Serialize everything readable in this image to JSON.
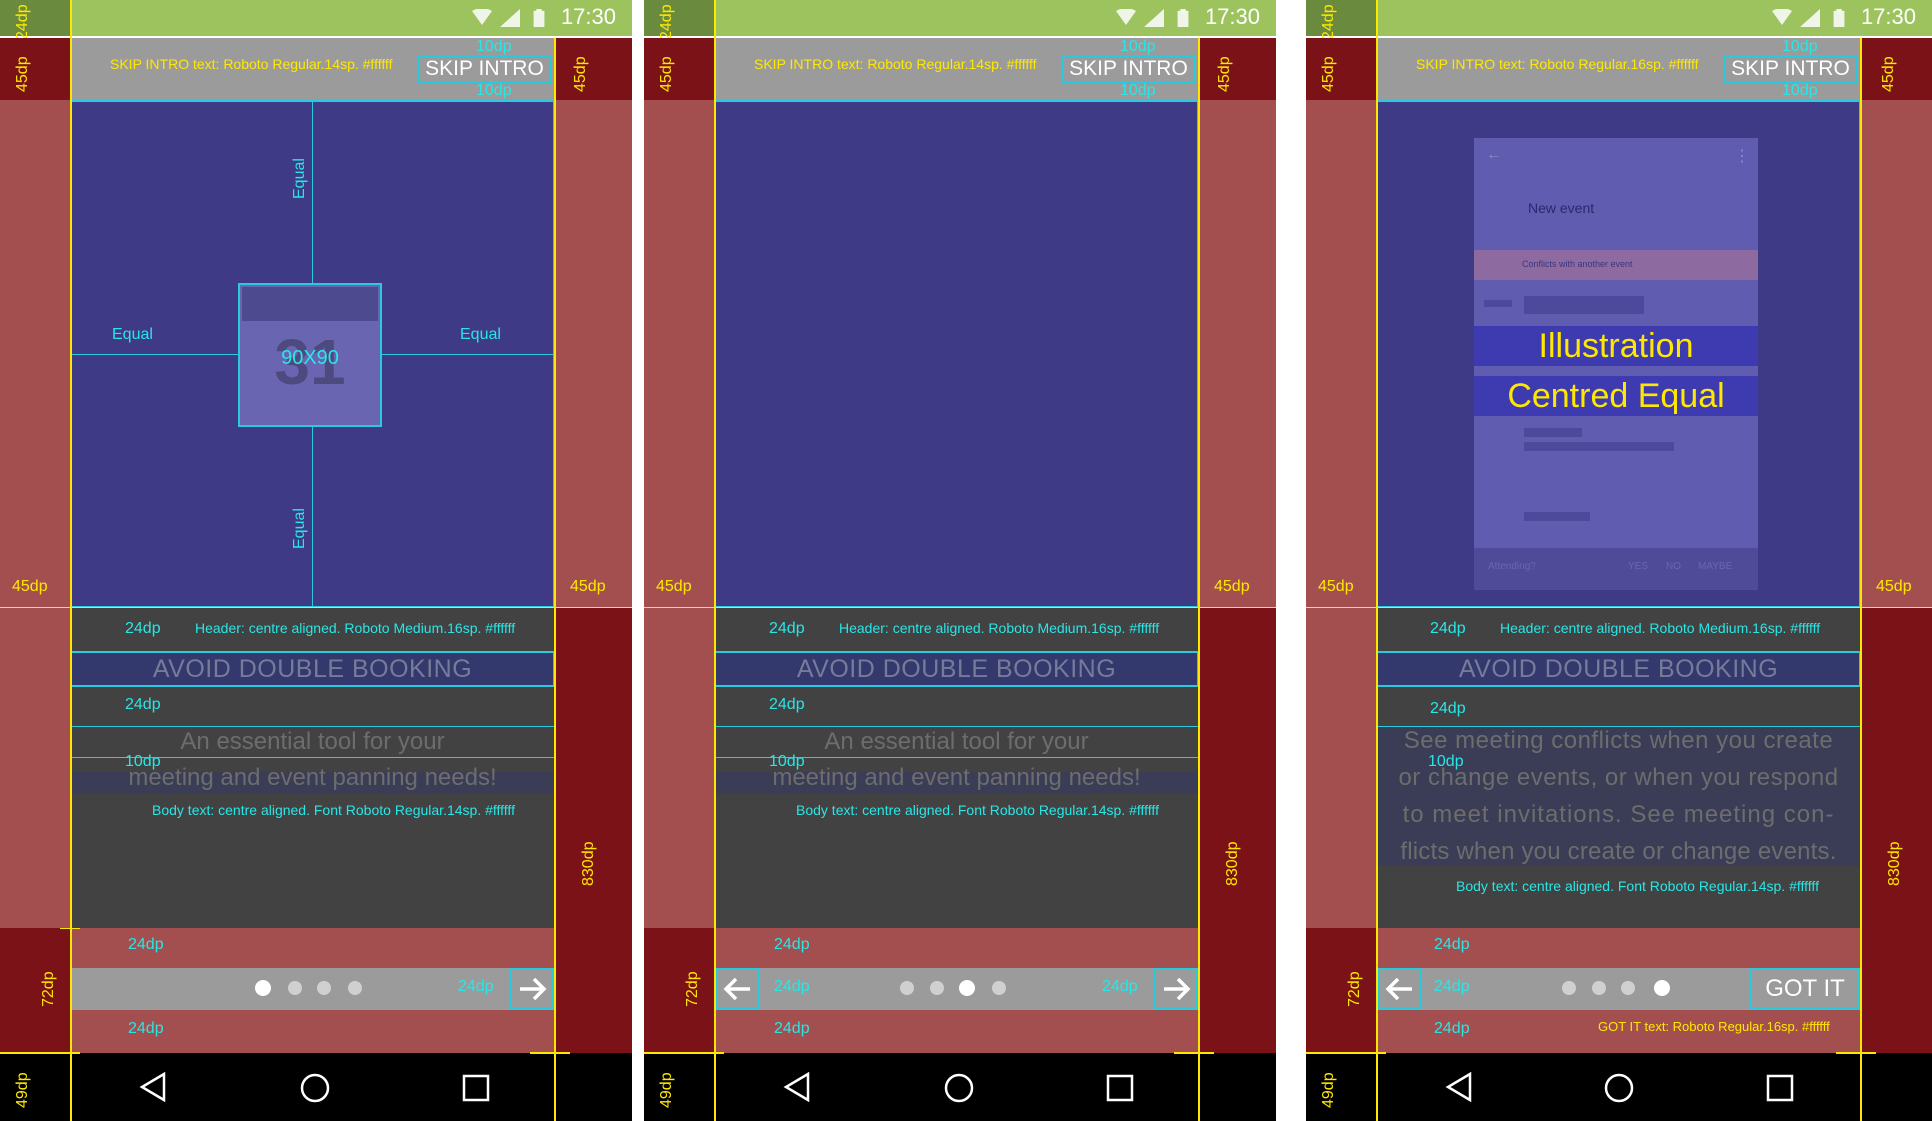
{
  "status": {
    "time": "17:30"
  },
  "skip_intro": {
    "label": "SKIP INTRO"
  },
  "annotations": {
    "skip_text_14": "SKIP INTRO text: Roboto Regular.14sp. #ffffff",
    "skip_text_16": "SKIP INTRO text: Roboto Regular.16sp. #ffffff",
    "header_spec": "Header: centre aligned. Roboto Medium.16sp. #ffffff",
    "body_spec": "Body text: centre aligned. Font Roboto Regular.14sp. #ffffff",
    "gotit_spec": "GOT IT text: Roboto Regular.16sp. #ffffff",
    "equal": "Equal",
    "size_90": "90X90",
    "cal_num": "31",
    "dp_24": "24dp",
    "dp_45": "45dp",
    "dp_10": "10dp",
    "dp_72": "72dp",
    "dp_49": "49dp",
    "dp_830": "830dp",
    "illustration": "Illustration",
    "centred_equal": "Centred Equal"
  },
  "screens": [
    {
      "header": "AVOID DOUBLE BOOKING",
      "body": [
        "An essential tool for your",
        "meeting and event panning needs!"
      ],
      "dots": 4,
      "active_dot": 0
    },
    {
      "header": "AVOID DOUBLE BOOKING",
      "body": [
        "An essential tool for your",
        "meeting and event panning needs!"
      ],
      "dots": 4,
      "active_dot": 2
    },
    {
      "header": "AVOID DOUBLE BOOKING",
      "body": [
        "See meeting conflicts when you create",
        "or change events, or when you respond",
        "to meet invitations. See meeting con-",
        "flicts when you create or change events."
      ],
      "dots": 4,
      "active_dot": 3
    }
  ],
  "mockup": {
    "title": "New event",
    "conflict": "Conflicts with another event",
    "attending": "Attending?",
    "yes": "YES",
    "no": "NO",
    "maybe": "MAYBE"
  },
  "gotit": {
    "label": "GOT IT"
  },
  "colors": {
    "statusbar": "#9dc35f",
    "margin_red": "#a44f4f",
    "dark_red": "#7a1218",
    "panel_blue": "#3e3a85",
    "guide_cyan": "#29c9e0",
    "guide_yellow": "#ffe800"
  }
}
